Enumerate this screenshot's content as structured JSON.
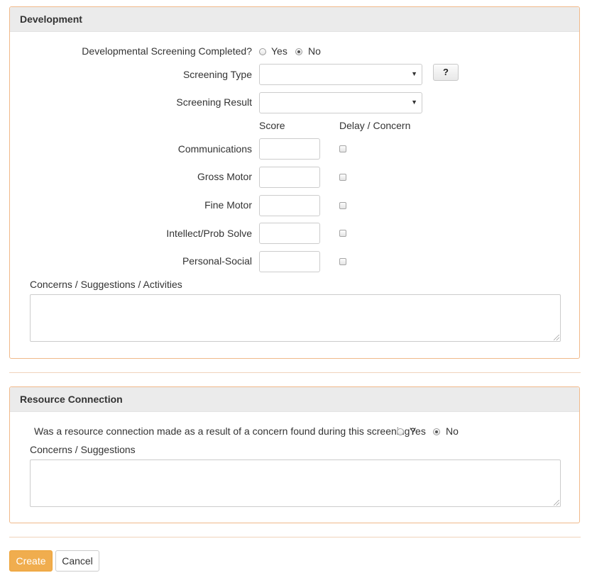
{
  "development": {
    "title": "Development",
    "screening_completed": {
      "label": "Developmental Screening Completed?",
      "yes": "Yes",
      "no": "No",
      "selected": "No"
    },
    "screening_type": {
      "label": "Screening Type",
      "value": "",
      "help": "?"
    },
    "screening_result": {
      "label": "Screening Result",
      "value": ""
    },
    "score_header": "Score",
    "delay_header": "Delay / Concern",
    "domains": [
      {
        "label": "Communications",
        "score": "",
        "delay": false
      },
      {
        "label": "Gross Motor",
        "score": "",
        "delay": false
      },
      {
        "label": "Fine Motor",
        "score": "",
        "delay": false
      },
      {
        "label": "Intellect/Prob Solve",
        "score": "",
        "delay": false
      },
      {
        "label": "Personal-Social",
        "score": "",
        "delay": false
      }
    ],
    "concerns_label": "Concerns / Suggestions / Activities",
    "concerns_value": ""
  },
  "resource": {
    "title": "Resource Connection",
    "question": {
      "label": "Was a resource connection made as a result of a concern found during this screening?",
      "yes": "Yes",
      "no": "No",
      "selected": "No"
    },
    "concerns_label": "Concerns / Suggestions",
    "concerns_value": ""
  },
  "actions": {
    "create": "Create",
    "cancel": "Cancel"
  },
  "colors": {
    "accent": "#f0ad4e",
    "panel_border": "#f0b98a",
    "header_bg": "#ebebeb"
  }
}
